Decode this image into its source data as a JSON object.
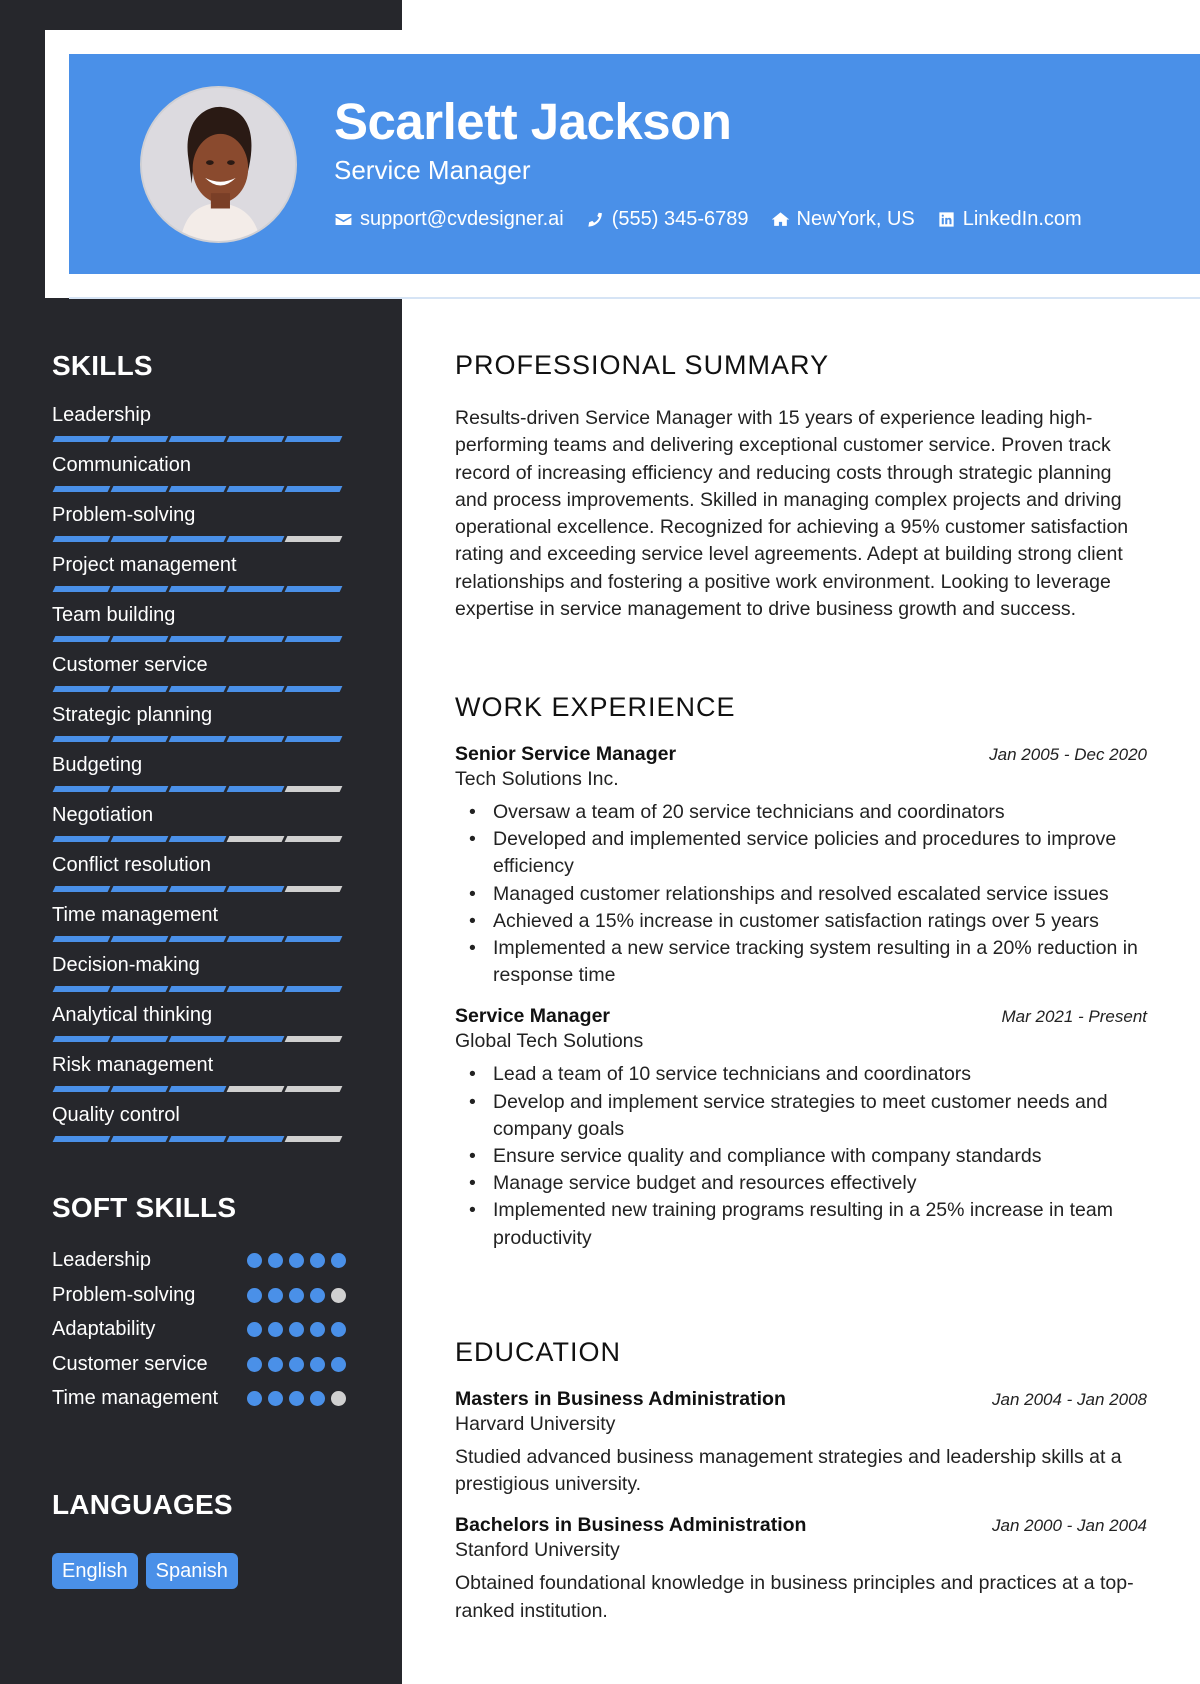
{
  "header": {
    "name": "Scarlett Jackson",
    "title": "Service Manager",
    "contacts": [
      {
        "icon": "envelope-icon",
        "text": "support@cvdesigner.ai"
      },
      {
        "icon": "phone-icon",
        "text": "(555) 345-6789"
      },
      {
        "icon": "home-icon",
        "text": "NewYork, US"
      },
      {
        "icon": "linkedin-icon",
        "text": "LinkedIn.com"
      }
    ]
  },
  "colors": {
    "accent": "#4a90e8",
    "sidebar": "#26272c",
    "inactive": "#d0d0d0"
  },
  "sidebar": {
    "skills_heading": "SKILLS",
    "skills": [
      {
        "name": "Leadership",
        "level": 5,
        "max": 5
      },
      {
        "name": "Communication",
        "level": 5,
        "max": 5
      },
      {
        "name": "Problem-solving",
        "level": 4,
        "max": 5
      },
      {
        "name": "Project management",
        "level": 5,
        "max": 5
      },
      {
        "name": "Team building",
        "level": 5,
        "max": 5
      },
      {
        "name": "Customer service",
        "level": 5,
        "max": 5
      },
      {
        "name": "Strategic planning",
        "level": 5,
        "max": 5
      },
      {
        "name": "Budgeting",
        "level": 4,
        "max": 5
      },
      {
        "name": "Negotiation",
        "level": 3,
        "max": 5
      },
      {
        "name": "Conflict resolution",
        "level": 4,
        "max": 5
      },
      {
        "name": "Time management",
        "level": 5,
        "max": 5
      },
      {
        "name": "Decision-making",
        "level": 5,
        "max": 5
      },
      {
        "name": "Analytical thinking",
        "level": 4,
        "max": 5
      },
      {
        "name": "Risk management",
        "level": 3,
        "max": 5
      },
      {
        "name": "Quality control",
        "level": 4,
        "max": 5
      }
    ],
    "soft_skills_heading": "SOFT SKILLS",
    "soft_skills": [
      {
        "name": "Leadership",
        "level": 5,
        "max": 5
      },
      {
        "name": "Problem-solving",
        "level": 4,
        "max": 5
      },
      {
        "name": "Adaptability",
        "level": 5,
        "max": 5
      },
      {
        "name": "Customer service",
        "level": 5,
        "max": 5
      },
      {
        "name": "Time management",
        "level": 4,
        "max": 5
      }
    ],
    "languages_heading": "LANGUAGES",
    "languages": [
      "English",
      "Spanish"
    ]
  },
  "main": {
    "summary_heading": "PROFESSIONAL SUMMARY",
    "summary": "Results-driven Service Manager with 15 years of experience leading high-performing teams and delivering exceptional customer service. Proven track record of increasing efficiency and reducing costs through strategic planning and process improvements. Skilled in managing complex projects and driving operational excellence. Recognized for achieving a 95% customer satisfaction rating and exceeding service level agreements. Adept at building strong client relationships and fostering a positive work environment. Looking to leverage expertise in service management to drive business growth and success.",
    "experience_heading": "WORK EXPERIENCE",
    "experience": [
      {
        "title": "Senior Service Manager",
        "date": "Jan 2005 - Dec 2020",
        "company": "Tech Solutions Inc.",
        "bullets": [
          "Oversaw a team of 20 service technicians and coordinators",
          "Developed and implemented service policies and procedures to improve efficiency",
          "Managed customer relationships and resolved escalated service issues",
          "Achieved a 15% increase in customer satisfaction ratings over 5 years",
          "Implemented a new service tracking system resulting in a 20% reduction in response time"
        ]
      },
      {
        "title": "Service Manager",
        "date": "Mar 2021 - Present",
        "company": "Global Tech Solutions",
        "bullets": [
          "Lead a team of 10 service technicians and coordinators",
          "Develop and implement service strategies to meet customer needs and company goals",
          "Ensure service quality and compliance with company standards",
          "Manage service budget and resources effectively",
          "Implemented new training programs resulting in a 25% increase in team productivity"
        ]
      }
    ],
    "education_heading": "EDUCATION",
    "education": [
      {
        "degree": "Masters in Business Administration",
        "date": "Jan 2004 - Jan 2008",
        "school": "Harvard University",
        "description": "Studied advanced business management strategies and leadership skills at a prestigious university."
      },
      {
        "degree": "Bachelors in Business Administration",
        "date": "Jan 2000 - Jan 2004",
        "school": "Stanford University",
        "description": "Obtained foundational knowledge in business principles and practices at a top-ranked institution."
      }
    ]
  }
}
